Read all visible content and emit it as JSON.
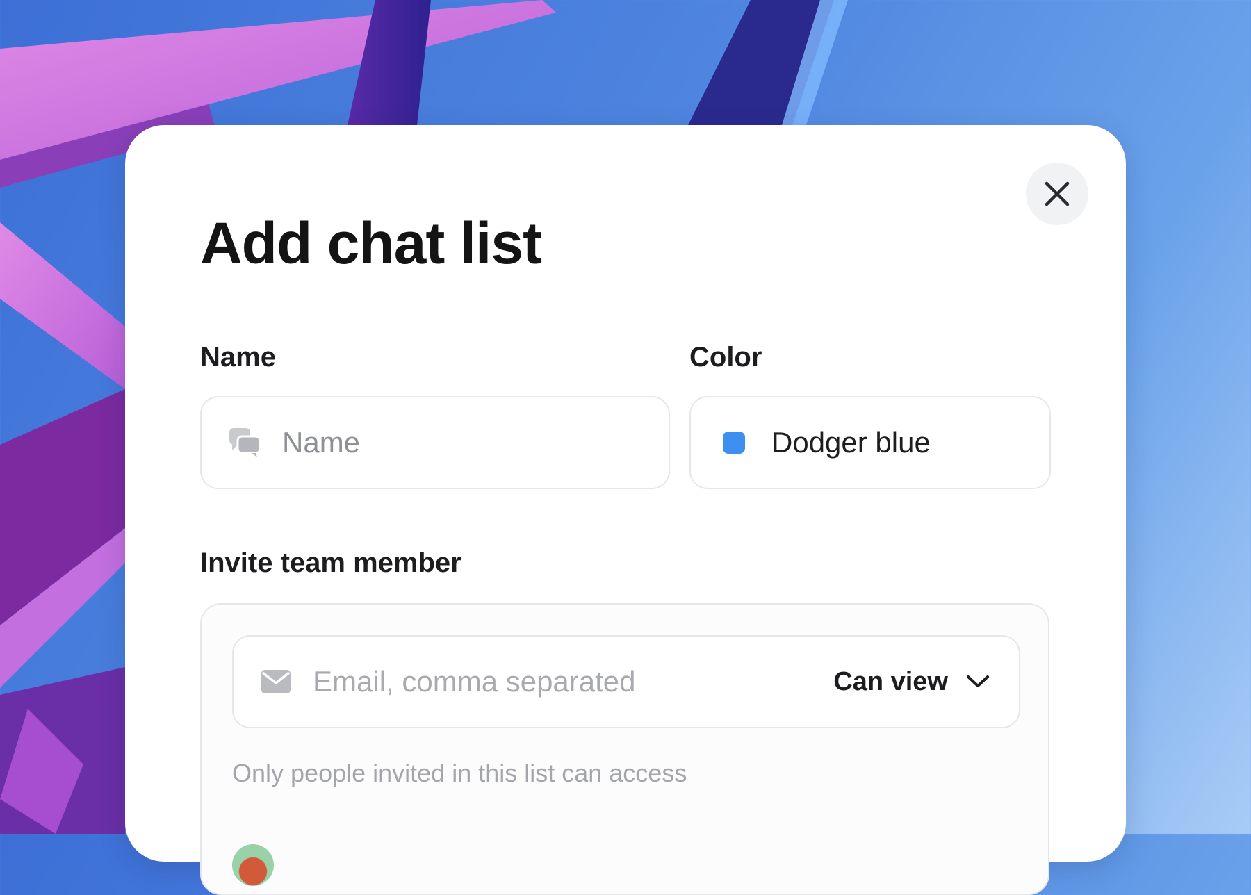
{
  "dialog": {
    "title": "Add chat list",
    "close_icon": "close-icon"
  },
  "form": {
    "name": {
      "label": "Name",
      "placeholder": "Name",
      "value": "",
      "icon": "chat-bubbles-icon"
    },
    "color": {
      "label": "Color",
      "value": "Dodger blue",
      "swatch": "#3d8ff0"
    },
    "invite": {
      "label": "Invite team member",
      "email_placeholder": "Email, comma separated",
      "email_value": "",
      "email_icon": "mail-icon",
      "permission": "Can view",
      "permission_icon": "chevron-down-icon",
      "hint": "Only people invited in this list can access"
    }
  },
  "colors": {
    "title": "#141414",
    "placeholder": "#8e9096",
    "hint": "#a3a5ab",
    "border": "#e6e7ea"
  }
}
